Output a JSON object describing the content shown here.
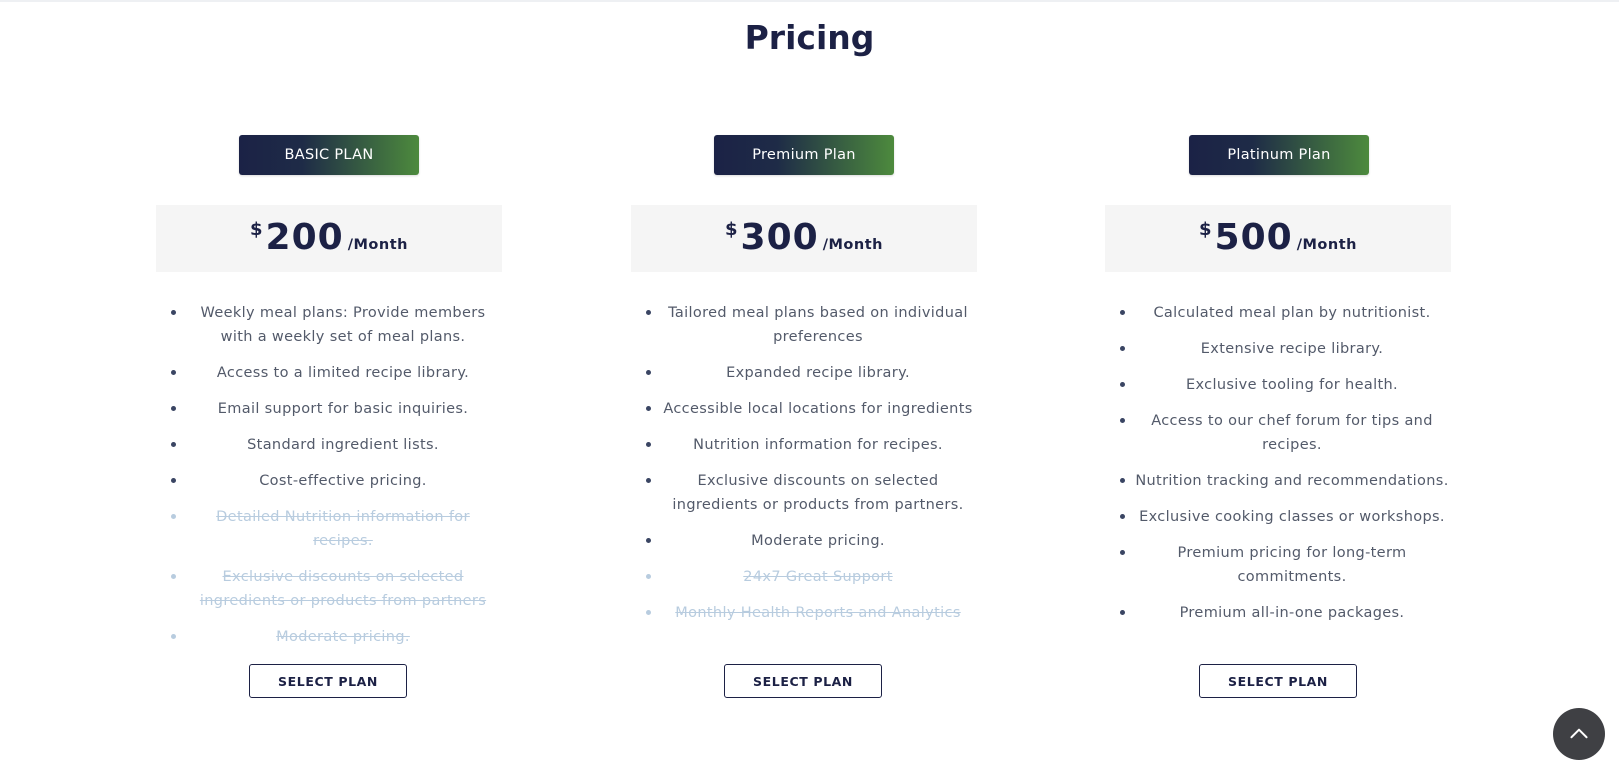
{
  "page": {
    "title": "Pricing"
  },
  "plans": [
    {
      "badge": "BASIC PLAN",
      "currency": "$",
      "amount": "200",
      "period": "/Month",
      "cta": "SELECT PLAN",
      "features": [
        {
          "text": "Weekly meal plans: Provide members with a weekly set of meal plans.",
          "included": true
        },
        {
          "text": "Access to a limited recipe library.",
          "included": true
        },
        {
          "text": "Email support for basic inquiries.",
          "included": true
        },
        {
          "text": "Standard ingredient lists.",
          "included": true
        },
        {
          "text": "Cost-effective pricing.",
          "included": true
        },
        {
          "text": "Detailed Nutrition information for recipes.",
          "included": false
        },
        {
          "text": "Exclusive discounts on selected ingredients or products from partners",
          "included": false
        },
        {
          "text": "Moderate pricing.",
          "included": false
        }
      ]
    },
    {
      "badge": "Premium Plan",
      "currency": "$",
      "amount": "300",
      "period": "/Month",
      "cta": "SELECT PLAN",
      "features": [
        {
          "text": "Tailored meal plans based on individual preferences",
          "included": true
        },
        {
          "text": "Expanded recipe library.",
          "included": true
        },
        {
          "text": "Accessible local locations for ingredients",
          "included": true
        },
        {
          "text": "Nutrition information for recipes.",
          "included": true
        },
        {
          "text": "Exclusive discounts on selected ingredients or products from partners.",
          "included": true
        },
        {
          "text": "Moderate pricing.",
          "included": true
        },
        {
          "text": "24x7 Great Support",
          "included": false
        },
        {
          "text": "Monthly Health Reports and Analytics",
          "included": false
        }
      ]
    },
    {
      "badge": "Platinum Plan",
      "currency": "$",
      "amount": "500",
      "period": "/Month",
      "cta": "SELECT PLAN",
      "features": [
        {
          "text": "Calculated meal plan by nutritionist.",
          "included": true
        },
        {
          "text": "Extensive recipe library.",
          "included": true
        },
        {
          "text": "Exclusive tooling for health.",
          "included": true
        },
        {
          "text": "Access to our chef forum for tips and recipes.",
          "included": true
        },
        {
          "text": "Nutrition tracking and recommendations.",
          "included": true
        },
        {
          "text": "Exclusive cooking classes or workshops.",
          "included": true
        },
        {
          "text": "Premium pricing for long-term commitments.",
          "included": true
        },
        {
          "text": "Premium all-in-one packages.",
          "included": true
        }
      ]
    }
  ],
  "scroll_top": {
    "icon": "chevron-up-icon"
  },
  "colors": {
    "heading": "#1c2145",
    "badge_gradient_start": "#1b2246",
    "badge_gradient_end": "#4d8a3d",
    "price_box_bg": "#f5f5f5",
    "feature_text": "#535a6a",
    "feature_disabled": "#b8ccdf",
    "scroll_button_bg": "#3f4044"
  }
}
